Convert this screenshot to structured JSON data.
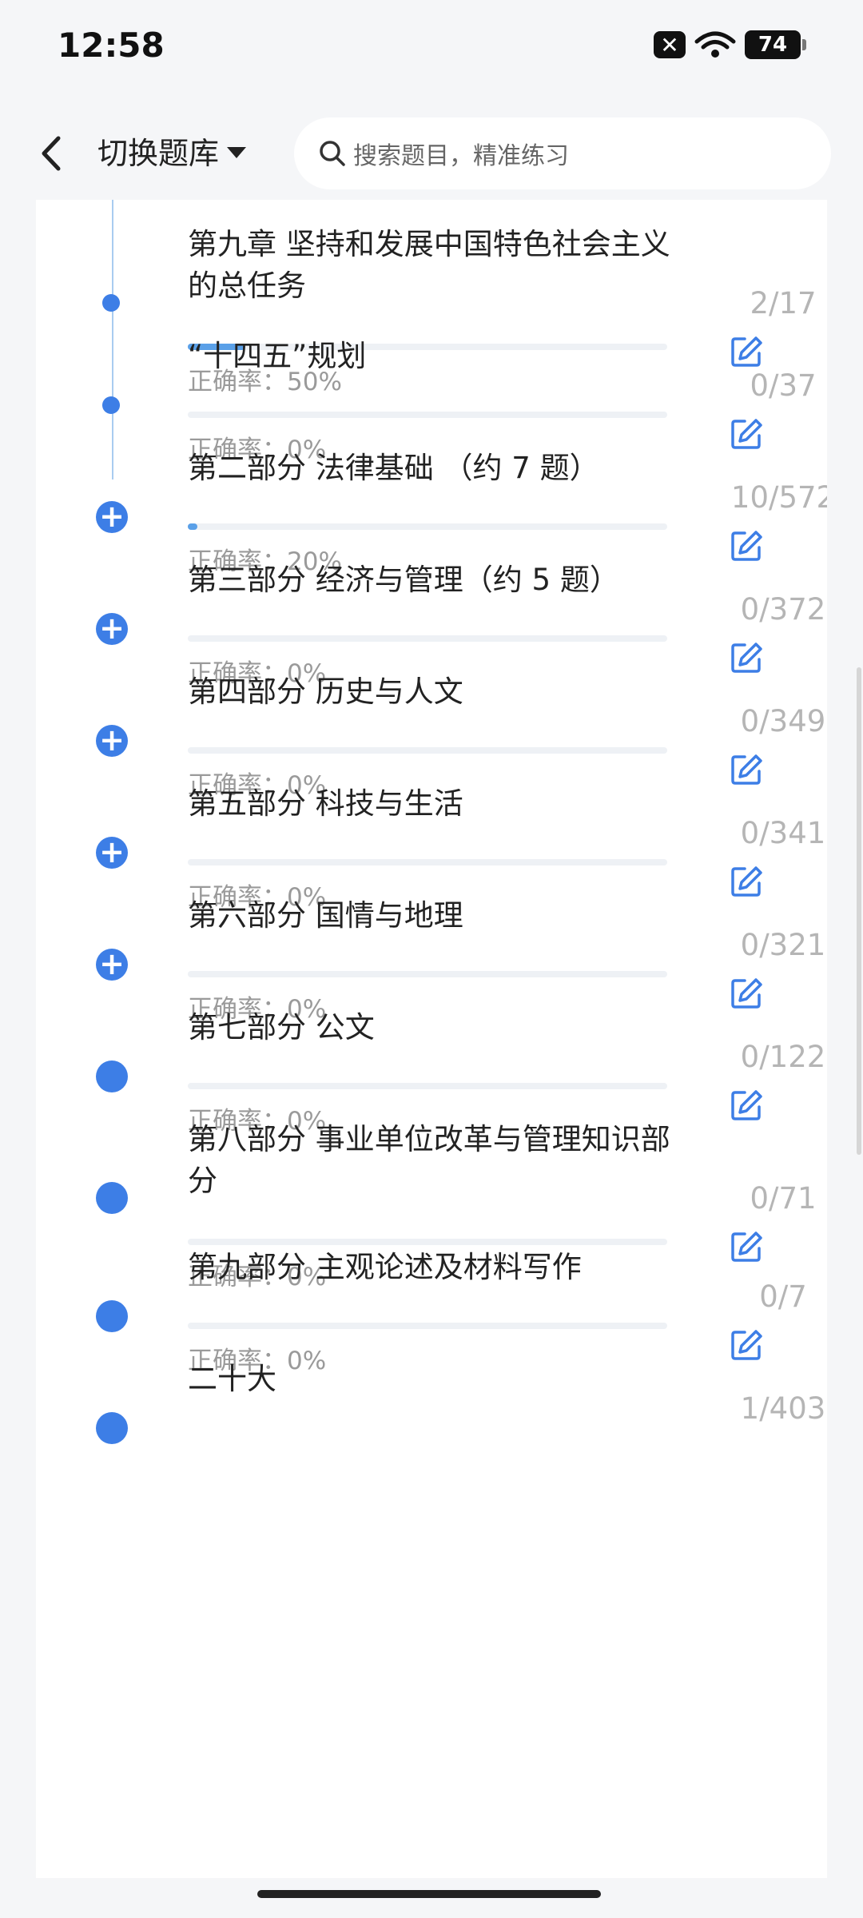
{
  "status": {
    "time": "12:58",
    "battery": "74"
  },
  "header": {
    "switch_label": "切换题库",
    "search_placeholder": "搜索题目，精准练习"
  },
  "items": [
    {
      "title": "第九章 坚持和发展中国特色社会主义的总任务",
      "accuracy": "正确率：50%",
      "count": "2/17",
      "progress": 0.12,
      "marker": "small"
    },
    {
      "title": "“十四五”规划",
      "accuracy": "正确率：0%",
      "count": "0/37",
      "progress": 0,
      "marker": "small"
    },
    {
      "title": "第二部分 法律基础 （约 7 题）",
      "accuracy": "正确率：20%",
      "count": "10/572",
      "progress": 0.02,
      "marker": "plus"
    },
    {
      "title": "第三部分 经济与管理（约 5 题）",
      "accuracy": "正确率：0%",
      "count": "0/372",
      "progress": 0,
      "marker": "plus"
    },
    {
      "title": "第四部分 历史与人文",
      "accuracy": "正确率：0%",
      "count": "0/349",
      "progress": 0,
      "marker": "plus"
    },
    {
      "title": "第五部分 科技与生活",
      "accuracy": "正确率：0%",
      "count": "0/341",
      "progress": 0,
      "marker": "plus"
    },
    {
      "title": "第六部分 国情与地理",
      "accuracy": "正确率：0%",
      "count": "0/321",
      "progress": 0,
      "marker": "plus"
    },
    {
      "title": "第七部分 公文",
      "accuracy": "正确率：0%",
      "count": "0/122",
      "progress": 0,
      "marker": "big"
    },
    {
      "title": "第八部分 事业单位改革与管理知识部分",
      "accuracy": "正确率：0%",
      "count": "0/71",
      "progress": 0,
      "marker": "big"
    },
    {
      "title": "第九部分 主观论述及材料写作",
      "accuracy": "正确率：0%",
      "count": "0/7",
      "progress": 0,
      "marker": "big"
    },
    {
      "title": "二十大",
      "accuracy": "",
      "count": "1/403",
      "progress": 0,
      "marker": "big"
    }
  ],
  "colors": {
    "accent": "#3d7ee6",
    "progress": "#5aa0e8",
    "muted": "#9a9a9a"
  }
}
